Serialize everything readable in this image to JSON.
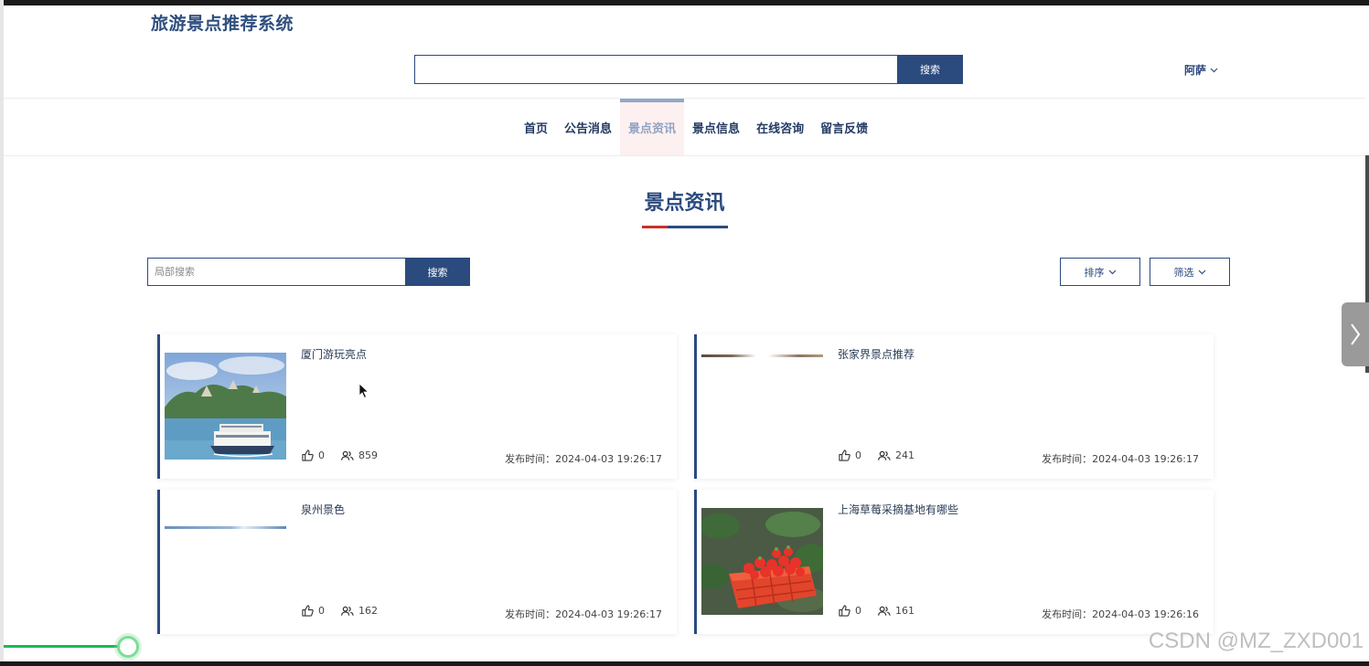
{
  "header": {
    "site_title": "旅游景点推荐系统",
    "search_value": "",
    "search_button": "搜索",
    "user_name": "阿萨"
  },
  "nav": {
    "items": [
      {
        "label": "首页"
      },
      {
        "label": "公告消息"
      },
      {
        "label": "景点资讯",
        "active": true
      },
      {
        "label": "景点信息"
      },
      {
        "label": "在线咨询"
      },
      {
        "label": "留言反馈"
      }
    ]
  },
  "main": {
    "heading": "景点资讯",
    "local_search_placeholder": "局部搜索",
    "local_search_button": "搜索",
    "sort_label": "排序",
    "filter_label": "筛选"
  },
  "articles": [
    {
      "title": "厦门游玩亮点",
      "likes": "0",
      "views": "859",
      "published": "发布时间：2024-04-03 19:26:17",
      "image": "ferry-boat-island"
    },
    {
      "title": "张家界景点推荐",
      "likes": "0",
      "views": "241",
      "published": "发布时间：2024-04-03 19:26:17",
      "image": "loading-strip"
    },
    {
      "title": "泉州景色",
      "likes": "0",
      "views": "162",
      "published": "发布时间：2024-04-03 19:26:17",
      "image": "loading-strip"
    },
    {
      "title": "上海草莓采摘基地有哪些",
      "likes": "0",
      "views": "161",
      "published": "发布时间：2024-04-03 19:26:16",
      "image": "strawberry-basket"
    }
  ],
  "overlay": {
    "watermark": "CSDN @MZ_ZXD001",
    "video_progress": 0.09
  },
  "colors": {
    "primary": "#2b4a7e",
    "accent_red": "#c9302c",
    "progress_green": "#1db954"
  }
}
